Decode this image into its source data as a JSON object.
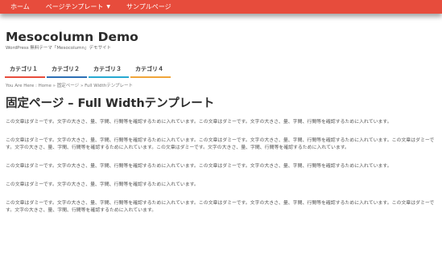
{
  "topnav": {
    "items": [
      {
        "label": "ホーム",
        "has_dropdown": false
      },
      {
        "label": "ページテンプレート",
        "has_dropdown": true
      },
      {
        "label": "サンプルページ",
        "has_dropdown": false
      }
    ],
    "bg_color": "#e74c3c"
  },
  "site": {
    "title": "Mesocolumn Demo",
    "description": "WordPress 無料テーマ「Mesocolumn」デモサイト"
  },
  "categories": [
    {
      "label": "カテゴリ１",
      "color": "#e74c3c"
    },
    {
      "label": "カテゴリ２",
      "color": "#2c6fb5"
    },
    {
      "label": "カテゴリ３",
      "color": "#27a8d1"
    },
    {
      "label": "カテゴリ４",
      "color": "#f0a53a"
    }
  ],
  "breadcrumb": {
    "prefix": "You Are Here :",
    "home": "Home",
    "sep1": "»",
    "parent": "固定ページ",
    "sep2": "»",
    "current": "Full Widthテンプレート"
  },
  "page": {
    "title": "固定ページ – Full Widthテンプレート",
    "paragraphs": [
      "この文章はダミーです。文字の大きさ、量、字間、行間等を確認するために入れています。この文章はダミーです。文字の大きさ、量、字間、行間等を確認するために入れています。",
      "この文章はダミーです。文字の大きさ、量、字間、行間等を確認するために入れています。この文章はダミーです。文字の大きさ、量、字間、行間等を確認するために入れています。この文章はダミーです。文字の大きさ、量、字間、行間等を確認するために入れています。この文章はダミーです。文字の大きさ、量、字間、行間等を確認するために入れています。",
      "この文章はダミーです。文字の大きさ、量、字間、行間等を確認するために入れています。この文章はダミーです。文字の大きさ、量、字間、行間等を確認するために入れています。",
      "この文章はダミーです。文字の大きさ、量、字間、行間等を確認するために入れています。",
      "この文章はダミーです。文字の大きさ、量、字間、行間等を確認するために入れています。この文章はダミーです。文字の大きさ、量、字間、行間等を確認するために入れています。この文章はダミーです。文字の大きさ、量、字間、行間等を確認するために入れています。"
    ]
  }
}
